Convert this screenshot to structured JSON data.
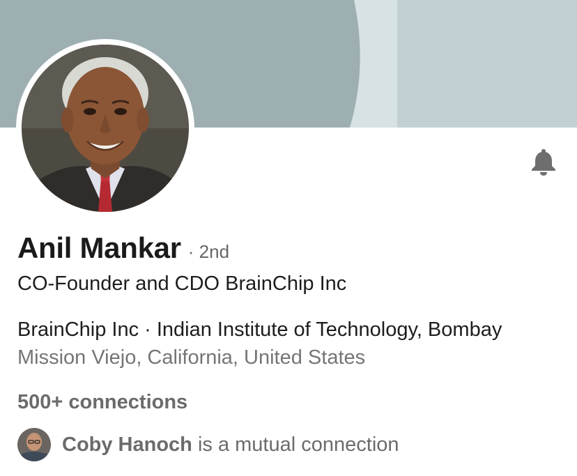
{
  "profile": {
    "name": "Anil Mankar",
    "degree_text": "· 2nd",
    "headline": "CO-Founder and CDO BrainChip Inc",
    "current_positions": "BrainChip Inc · Indian Institute of Technology, Bombay",
    "location": "Mission Viejo, California, United States",
    "connections": "500+ connections"
  },
  "mutual": {
    "name": "Coby Hanoch",
    "suffix": " is a mutual connection"
  },
  "icons": {
    "notify": "bell-icon"
  },
  "colors": {
    "banner_dark": "#9fb0b3",
    "banner_mid": "#d6e1e3",
    "banner_light": "#c3d0d3",
    "text_primary": "#1d1d1d",
    "text_secondary": "#757575"
  }
}
